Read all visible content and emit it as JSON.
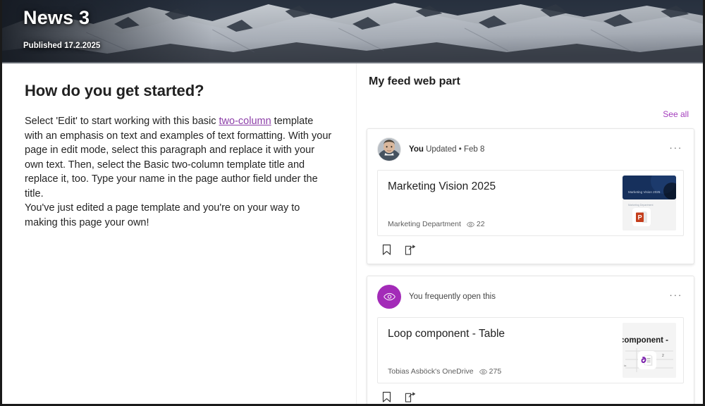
{
  "hero": {
    "title": "News 3",
    "published": "Published 17.2.2025",
    "image_alt": "snowy-mountain-banner"
  },
  "left_column": {
    "heading": "How do you get started?",
    "paragraph_before_link": "Select 'Edit' to start working with this basic ",
    "link_text": "two-column",
    "paragraph_after_link": " template with an emphasis on text and examples of text formatting. With your page in edit mode, select this paragraph and replace it with your own text. Then, select the Basic two-column template title and replace it, too. Type your name in the page author field under the title.",
    "paragraph_two": "You've just edited a page template and you're on your way to making this page your own!"
  },
  "right_column": {
    "web_part_title": "My feed web part",
    "see_all_label": "See all",
    "overflow_label": "···",
    "cards": [
      {
        "avatar_type": "photo",
        "avatar_name": "user-avatar-photo",
        "actor": "You",
        "activity": " Updated • Feb 8",
        "doc_title": "Marketing Vision 2025",
        "source": "Marketing Department",
        "views": "22",
        "thumbnail_type": "powerpoint",
        "thumbnail_text": "Marketing Vision 2025",
        "thumbnail_subtext": "Marketing Department",
        "bookmark_label": "Save",
        "share_label": "Share"
      },
      {
        "avatar_type": "icon",
        "avatar_name": "frequently-opened-eye-icon",
        "actor": "",
        "activity": "You frequently open this",
        "doc_title": "Loop component - Table",
        "source": "Tobias Asböck's OneDrive",
        "views": "275",
        "thumbnail_type": "loop",
        "thumbnail_text": "component -",
        "thumbnail_subtext": "2",
        "bookmark_label": "Save",
        "share_label": "Share"
      }
    ]
  },
  "colors": {
    "accent_purple": "#a43ebd",
    "link_purple": "#8c3ea8",
    "avatar_purple": "#a32bb8",
    "text_primary": "#212121",
    "powerpoint_red": "#c43e1c",
    "loop_purple": "#7719aa"
  }
}
